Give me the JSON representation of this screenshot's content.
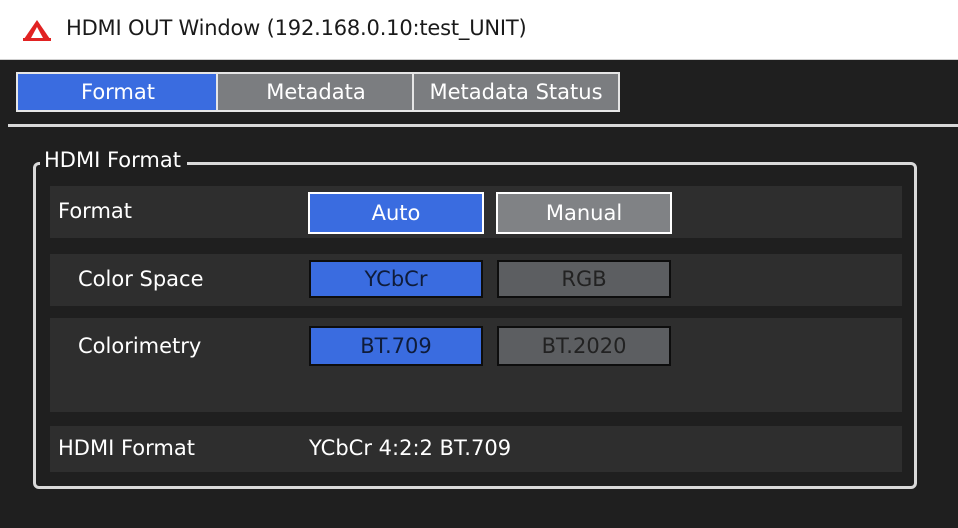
{
  "window": {
    "title": "HDMI OUT Window (192.168.0.10:test_UNIT)",
    "icon": "app-logo-icon",
    "accent_color": "#3a6ce0"
  },
  "tabs": [
    {
      "label": "Format",
      "active": true
    },
    {
      "label": "Metadata",
      "active": false
    },
    {
      "label": "Metadata Status",
      "active": false
    }
  ],
  "group": {
    "title": "HDMI Format",
    "rows": {
      "format": {
        "label": "Format",
        "options": [
          "Auto",
          "Manual"
        ],
        "selected": "Auto"
      },
      "color_space": {
        "label": "Color Space",
        "options": [
          "YCbCr",
          "RGB"
        ],
        "selected": "YCbCr"
      },
      "colorimetry": {
        "label": "Colorimetry",
        "options": [
          "BT.709",
          "BT.2020"
        ],
        "selected": "BT.709"
      },
      "hdmi_format": {
        "label": "HDMI Format",
        "value": "YCbCr 4:2:2 BT.709"
      }
    }
  }
}
